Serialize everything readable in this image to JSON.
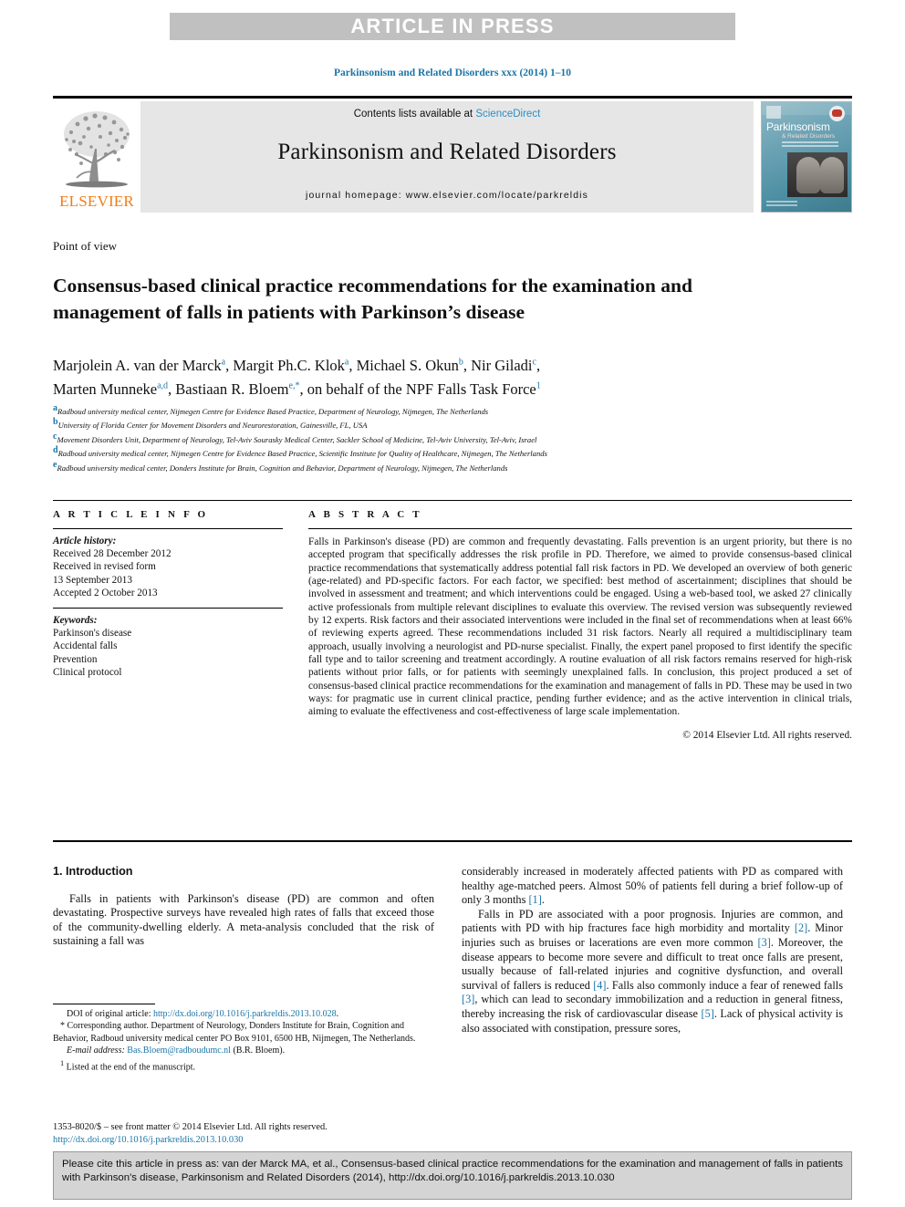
{
  "banner": {
    "text": "ARTICLE IN PRESS"
  },
  "journal_ref": "Parkinsonism and Related Disorders xxx (2014) 1–10",
  "masthead": {
    "publisher_word": "ELSEVIER",
    "contents_prefix": "Contents lists available at ",
    "contents_link": "ScienceDirect",
    "journal_title": "Parkinsonism and Related Disorders",
    "homepage": "journal homepage: www.elsevier.com/locate/parkreldis",
    "cover_title": "Parkinsonism",
    "cover_subtitle": "& Related Disorders"
  },
  "article": {
    "type": "Point of view",
    "title": "Consensus-based clinical practice recommendations for the examination and management of falls in patients with Parkinson’s disease",
    "authors_line1_names": [
      {
        "name": "Marjolein A. van der Marck",
        "sup": "a"
      },
      {
        "name": "Margit Ph.C. Klok",
        "sup": "a"
      },
      {
        "name": "Michael S. Okun",
        "sup": "b"
      },
      {
        "name": "Nir Giladi",
        "sup": "c"
      }
    ],
    "authors_line2_names": [
      {
        "name": "Marten Munneke",
        "sup": "a,d"
      },
      {
        "name": "Bastiaan R. Bloem",
        "sup": "e,*"
      }
    ],
    "authors_tail": ", on behalf of the NPF Falls Task Force",
    "authors_tail_sup": "1",
    "affiliations": [
      {
        "sup": "a",
        "text": "Radboud university medical center, Nijmegen Centre for Evidence Based Practice, Department of Neurology, Nijmegen, The Netherlands"
      },
      {
        "sup": "b",
        "text": "University of Florida Center for Movement Disorders and Neurorestoration, Gainesville, FL, USA"
      },
      {
        "sup": "c",
        "text": "Movement Disorders Unit, Department of Neurology, Tel-Aviv Sourasky Medical Center, Sackler School of Medicine, Tel-Aviv University, Tel-Aviv, Israel"
      },
      {
        "sup": "d",
        "text": "Radboud university medical center, Nijmegen Centre for Evidence Based Practice, Scientific Institute for Quality of Healthcare, Nijmegen, The Netherlands"
      },
      {
        "sup": "e",
        "text": "Radboud university medical center, Donders Institute for Brain, Cognition and Behavior, Department of Neurology, Nijmegen, The Netherlands"
      }
    ]
  },
  "article_info": {
    "heading": "A R T I C L E  I N F O",
    "history_label": "Article history:",
    "history_lines": [
      "Received 28 December 2012",
      "Received in revised form",
      "13 September 2013",
      "Accepted 2 October 2013"
    ],
    "keywords_label": "Keywords:",
    "keywords": [
      "Parkinson's disease",
      "Accidental falls",
      "Prevention",
      "Clinical protocol"
    ]
  },
  "abstract": {
    "heading": "A B S T R A C T",
    "text": "Falls in Parkinson's disease (PD) are common and frequently devastating. Falls prevention is an urgent priority, but there is no accepted program that specifically addresses the risk profile in PD. Therefore, we aimed to provide consensus-based clinical practice recommendations that systematically address potential fall risk factors in PD. We developed an overview of both generic (age-related) and PD-specific factors. For each factor, we specified: best method of ascertainment; disciplines that should be involved in assessment and treatment; and which interventions could be engaged. Using a web-based tool, we asked 27 clinically active professionals from multiple relevant disciplines to evaluate this overview. The revised version was subsequently reviewed by 12 experts. Risk factors and their associated interventions were included in the final set of recommendations when at least 66% of reviewing experts agreed. These recommendations included 31 risk factors. Nearly all required a multidisciplinary team approach, usually involving a neurologist and PD-nurse specialist. Finally, the expert panel proposed to first identify the specific fall type and to tailor screening and treatment accordingly. A routine evaluation of all risk factors remains reserved for high-risk patients without prior falls, or for patients with seemingly unexplained falls. In conclusion, this project produced a set of consensus-based clinical practice recommendations for the examination and management of falls in PD. These may be used in two ways: for pragmatic use in current clinical practice, pending further evidence; and as the active intervention in clinical trials, aiming to evaluate the effectiveness and cost-effectiveness of large scale implementation.",
    "copyright": "© 2014 Elsevier Ltd. All rights reserved."
  },
  "body": {
    "section_heading": "1. Introduction",
    "left_paragraph": "Falls in patients with Parkinson's disease (PD) are common and often devastating. Prospective surveys have revealed high rates of falls that exceed those of the community-dwelling elderly. A meta-analysis concluded that the risk of sustaining a fall was",
    "right_par1_a": "considerably increased in moderately affected patients with PD as compared with healthy age-matched peers. Almost 50% of patients fell during a brief follow-up of only 3 months ",
    "right_par1_ref": "[1]",
    "right_par1_b": ".",
    "right_par2_segments": [
      {
        "t": "Falls in PD are associated with a poor prognosis. Injuries are common, and patients with PD with hip fractures face high morbidity and mortality ",
        "ref": false
      },
      {
        "t": "[2]",
        "ref": true
      },
      {
        "t": ". Minor injuries such as bruises or lacerations are even more common ",
        "ref": false
      },
      {
        "t": "[3]",
        "ref": true
      },
      {
        "t": ". Moreover, the disease appears to become more severe and difficult to treat once falls are present, usually because of fall-related injuries and cognitive dysfunction, and overall survival of fallers is reduced ",
        "ref": false
      },
      {
        "t": "[4]",
        "ref": true
      },
      {
        "t": ". Falls also commonly induce a fear of renewed falls ",
        "ref": false
      },
      {
        "t": "[3]",
        "ref": true
      },
      {
        "t": ", which can lead to secondary immobilization and a reduction in general fitness, thereby increasing the risk of cardiovascular disease ",
        "ref": false
      },
      {
        "t": "[5]",
        "ref": true
      },
      {
        "t": ". Lack of physical activity is also associated with constipation, pressure sores,",
        "ref": false
      }
    ]
  },
  "footnotes": {
    "doi_label": "DOI of original article: ",
    "doi_link": "http://dx.doi.org/10.1016/j.parkreldis.2013.10.028",
    "doi_tail": ".",
    "corresponding_marker": "*",
    "corresponding_text": "Corresponding author. Department of Neurology, Donders Institute for Brain, Cognition and Behavior, Radboud university medical center PO Box 9101, 6500 HB, Nijmegen, The Netherlands.",
    "email_label": "E-mail address:",
    "email_link": "Bas.Bloem@radboudumc.nl",
    "email_tail": " (B.R. Bloem).",
    "note_marker": "1",
    "note_text": "Listed at the end of the manuscript.",
    "front_matter": "1353-8020/$ – see front matter © 2014 Elsevier Ltd. All rights reserved.",
    "front_matter_doi": "http://dx.doi.org/10.1016/j.parkreldis.2013.10.030"
  },
  "cite_box": {
    "text": "Please cite this article in press as: van der Marck MA, et al., Consensus-based clinical practice recommendations for the examination and management of falls in patients with Parkinson's disease, Parkinsonism and Related Disorders (2014), http://dx.doi.org/10.1016/j.parkreldis.2013.10.030"
  },
  "colors": {
    "link": "#1a75a7",
    "banner_bg": "#c0c0c0",
    "masthead_bg": "#e6e6e6",
    "elsevier_orange": "#ef7d1a",
    "cite_bg": "#d4d4d4"
  }
}
